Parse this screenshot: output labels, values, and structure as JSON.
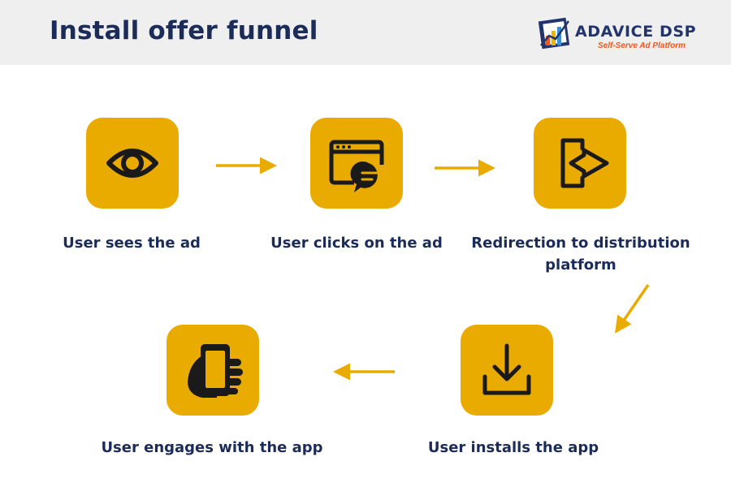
{
  "header": {
    "title": "Install offer funnel",
    "logo": {
      "name": "ADAVICE DSP",
      "tagline": "Self-Serve Ad Platform"
    }
  },
  "steps": [
    {
      "label": "User sees the ad",
      "icon": "eye-icon"
    },
    {
      "label": "User clicks on the ad",
      "icon": "browser-chat-icon"
    },
    {
      "label": "Redirection to distribution platform",
      "icon": "redirect-icon"
    },
    {
      "label": "User installs the app",
      "icon": "download-icon"
    },
    {
      "label": "User engages with the app",
      "icon": "hand-phone-icon"
    }
  ],
  "colors": {
    "accent": "#eaab00",
    "title": "#1c2c59",
    "header_bg": "#efefef",
    "logo_tagline": "#e85a1a"
  }
}
